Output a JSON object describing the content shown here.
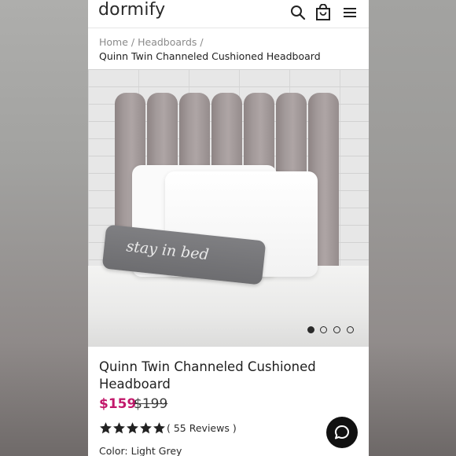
{
  "header": {
    "logo": "dormify",
    "icons": [
      "search-icon",
      "shopping-bag-icon",
      "menu-icon"
    ]
  },
  "breadcrumb": {
    "home": "Home",
    "separator": "/",
    "category": "Headboards",
    "current": "Quinn Twin Channeled Cushioned Headboard"
  },
  "image": {
    "pillow_text": "stay in bed",
    "carousel_total": 4,
    "carousel_active": 1
  },
  "product": {
    "title": "Quinn Twin Channeled Cushioned Headboard",
    "price": "$159",
    "compare_price": "$199",
    "rating": 5,
    "reviews_label": "( 55 Reviews )",
    "color_label": "Color: Light Grey"
  },
  "colors": {
    "price": "#c2186b",
    "text": "#1f1f1f",
    "chat_button": "#111111"
  }
}
